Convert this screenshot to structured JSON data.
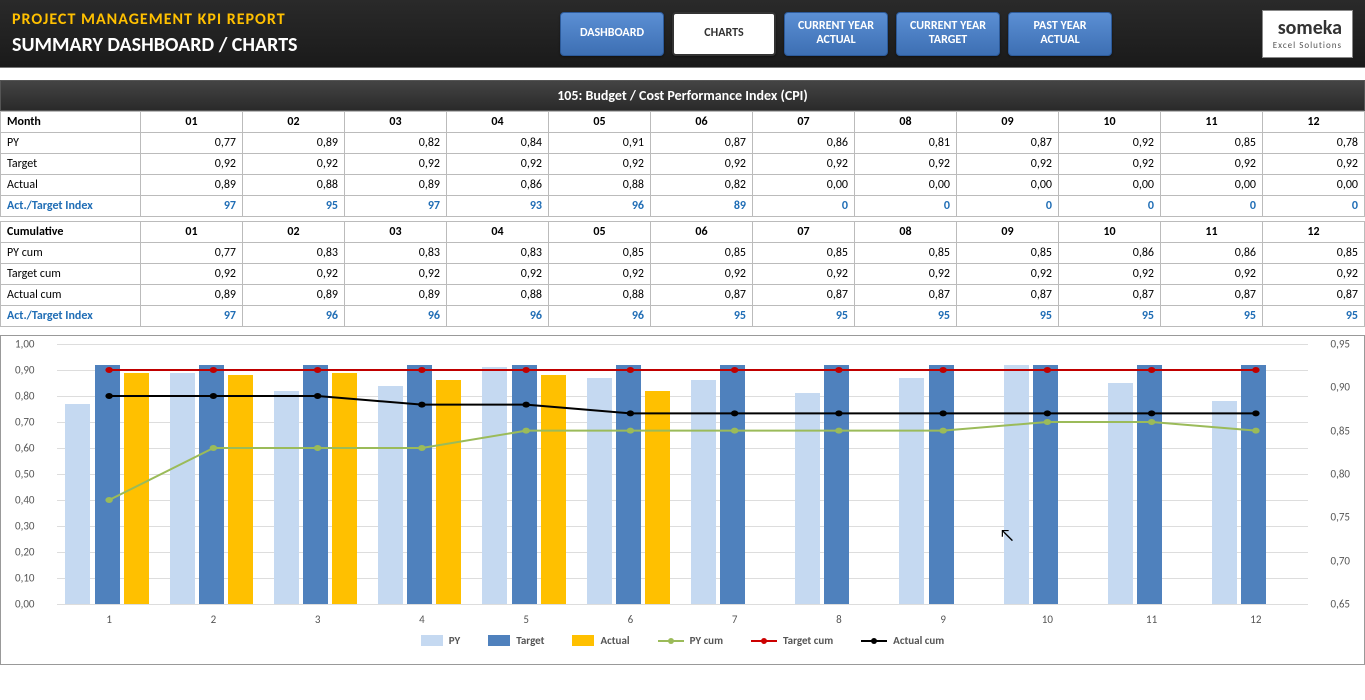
{
  "header": {
    "title": "PROJECT MANAGEMENT KPI REPORT",
    "subtitle": "SUMMARY DASHBOARD / CHARTS",
    "buttons": {
      "dashboard": "DASHBOARD",
      "charts": "CHARTS",
      "cy_actual": "CURRENT YEAR\nACTUAL",
      "cy_target": "CURRENT YEAR\nTARGET",
      "py_actual": "PAST YEAR\nACTUAL"
    },
    "logo": {
      "main": "someka",
      "sub": "Excel Solutions"
    }
  },
  "section_title": "105: Budget / Cost Performance Index (CPI)",
  "months": [
    "01",
    "02",
    "03",
    "04",
    "05",
    "06",
    "07",
    "08",
    "09",
    "10",
    "11",
    "12"
  ],
  "table1": {
    "label": "Month",
    "rows": {
      "py": {
        "label": "PY",
        "v": [
          "0,77",
          "0,89",
          "0,82",
          "0,84",
          "0,91",
          "0,87",
          "0,86",
          "0,81",
          "0,87",
          "0,92",
          "0,85",
          "0,78"
        ]
      },
      "target": {
        "label": "Target",
        "v": [
          "0,92",
          "0,92",
          "0,92",
          "0,92",
          "0,92",
          "0,92",
          "0,92",
          "0,92",
          "0,92",
          "0,92",
          "0,92",
          "0,92"
        ]
      },
      "actual": {
        "label": "Actual",
        "v": [
          "0,89",
          "0,88",
          "0,89",
          "0,86",
          "0,88",
          "0,82",
          "0,00",
          "0,00",
          "0,00",
          "0,00",
          "0,00",
          "0,00"
        ]
      },
      "index": {
        "label": "Act./Target Index",
        "v": [
          "97",
          "95",
          "97",
          "93",
          "96",
          "89",
          "0",
          "0",
          "0",
          "0",
          "0",
          "0"
        ]
      }
    }
  },
  "table2": {
    "label": "Cumulative",
    "rows": {
      "py": {
        "label": "PY cum",
        "v": [
          "0,77",
          "0,83",
          "0,83",
          "0,83",
          "0,85",
          "0,85",
          "0,85",
          "0,85",
          "0,85",
          "0,86",
          "0,86",
          "0,85"
        ]
      },
      "target": {
        "label": "Target cum",
        "v": [
          "0,92",
          "0,92",
          "0,92",
          "0,92",
          "0,92",
          "0,92",
          "0,92",
          "0,92",
          "0,92",
          "0,92",
          "0,92",
          "0,92"
        ]
      },
      "actual": {
        "label": "Actual cum",
        "v": [
          "0,89",
          "0,89",
          "0,89",
          "0,88",
          "0,88",
          "0,87",
          "0,87",
          "0,87",
          "0,87",
          "0,87",
          "0,87",
          "0,87"
        ]
      },
      "index": {
        "label": "Act./Target Index",
        "v": [
          "97",
          "96",
          "96",
          "96",
          "96",
          "95",
          "95",
          "95",
          "95",
          "95",
          "95",
          "95"
        ]
      }
    }
  },
  "legend": {
    "py": "PY",
    "target": "Target",
    "actual": "Actual",
    "pycum": "PY cum",
    "targetcum": "Target cum",
    "actualcum": "Actual cum"
  },
  "chart_data": {
    "type": "bar+line",
    "categories": [
      "1",
      "2",
      "3",
      "4",
      "5",
      "6",
      "7",
      "8",
      "9",
      "10",
      "11",
      "12"
    ],
    "left_axis": {
      "min": 0,
      "max": 1.0,
      "ticks": [
        "0,00",
        "0,10",
        "0,20",
        "0,30",
        "0,40",
        "0,50",
        "0,60",
        "0,70",
        "0,80",
        "0,90",
        "1,00"
      ]
    },
    "right_axis": {
      "min": 0.65,
      "max": 0.95,
      "ticks": [
        "0,65",
        "0,70",
        "0,75",
        "0,80",
        "0,85",
        "0,90",
        "0,95"
      ]
    },
    "series": [
      {
        "name": "PY",
        "type": "bar",
        "axis": "left",
        "color": "#c5d9f1",
        "values": [
          0.77,
          0.89,
          0.82,
          0.84,
          0.91,
          0.87,
          0.86,
          0.81,
          0.87,
          0.92,
          0.85,
          0.78
        ]
      },
      {
        "name": "Target",
        "type": "bar",
        "axis": "left",
        "color": "#4f81bd",
        "values": [
          0.92,
          0.92,
          0.92,
          0.92,
          0.92,
          0.92,
          0.92,
          0.92,
          0.92,
          0.92,
          0.92,
          0.92
        ]
      },
      {
        "name": "Actual",
        "type": "bar",
        "axis": "left",
        "color": "#ffc000",
        "values": [
          0.89,
          0.88,
          0.89,
          0.86,
          0.88,
          0.82,
          0,
          0,
          0,
          0,
          0,
          0
        ]
      },
      {
        "name": "PY cum",
        "type": "line",
        "axis": "right",
        "color": "#9bbb59",
        "values": [
          0.77,
          0.83,
          0.83,
          0.83,
          0.85,
          0.85,
          0.85,
          0.85,
          0.85,
          0.86,
          0.86,
          0.85
        ]
      },
      {
        "name": "Target cum",
        "type": "line",
        "axis": "right",
        "color": "#c00000",
        "values": [
          0.92,
          0.92,
          0.92,
          0.92,
          0.92,
          0.92,
          0.92,
          0.92,
          0.92,
          0.92,
          0.92,
          0.92
        ]
      },
      {
        "name": "Actual cum",
        "type": "line",
        "axis": "right",
        "color": "#000000",
        "values": [
          0.89,
          0.89,
          0.89,
          0.88,
          0.88,
          0.87,
          0.87,
          0.87,
          0.87,
          0.87,
          0.87,
          0.87
        ]
      }
    ]
  }
}
